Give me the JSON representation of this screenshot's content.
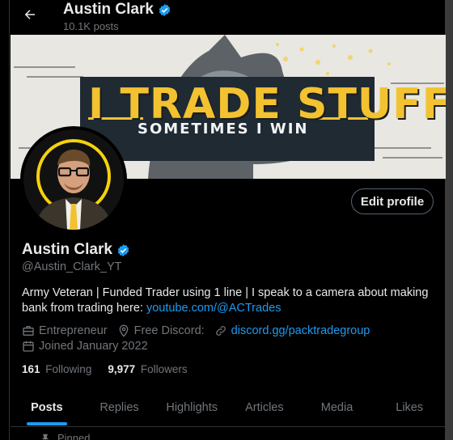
{
  "header": {
    "back_icon": "arrow-left-icon",
    "title": "Austin Clark",
    "posts_count": "10.1K posts"
  },
  "banner": {
    "line1": "I TRADE STUFF",
    "line2": "SOMETIMES I WIN",
    "accent": "#f2c230"
  },
  "profile": {
    "name": "Austin Clark",
    "handle": "@Austin_Clark_YT",
    "verified_icon": "verified-badge-icon",
    "edit_label": "Edit profile",
    "bio_text": "Army Veteran | Funded Trader using 1 line | I speak to a camera about making bank from trading here: ",
    "bio_link": "youtube.com/@ACTrades",
    "category": "Entrepreneur",
    "location": "Free Discord:",
    "url": "discord.gg/packtradegroup",
    "joined": "Joined January 2022",
    "following_count": "161",
    "following_label": "Following",
    "followers_count": "9,977",
    "followers_label": "Followers"
  },
  "tabs": [
    {
      "label": "Posts",
      "active": true
    },
    {
      "label": "Replies"
    },
    {
      "label": "Highlights"
    },
    {
      "label": "Articles"
    },
    {
      "label": "Media"
    },
    {
      "label": "Likes"
    }
  ],
  "pinned_label": "Pinned",
  "colors": {
    "link": "#1d9bf0",
    "muted": "#71767b",
    "text": "#e7e9ea",
    "background": "#000000"
  }
}
